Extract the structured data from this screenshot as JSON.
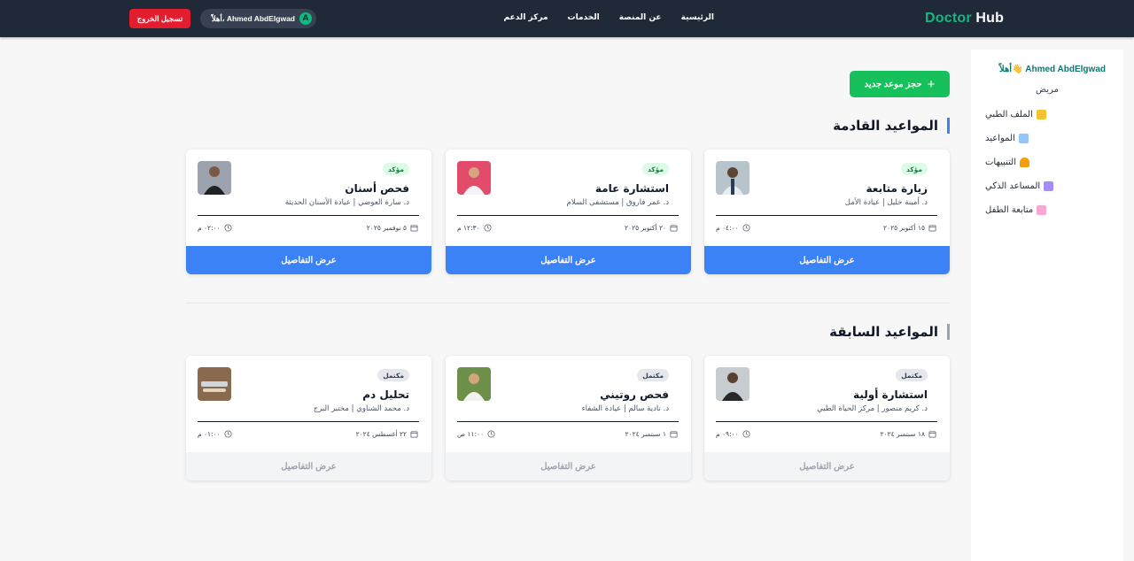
{
  "header": {
    "logo_part1": "Doctor",
    "logo_part2": "Hub",
    "nav": [
      "الرئيسية",
      "عن المنصة",
      "الخدمات",
      "مركز الدعم"
    ],
    "user_greeting": "أهلاً، Ahmed AbdElgwad",
    "user_initial": "A",
    "logout_label": "تسجيل الخروج"
  },
  "sidebar": {
    "greeting": "أهلاً👋 Ahmed AbdElgwad",
    "role": "مريض",
    "items": [
      {
        "label": "الملف الطبي",
        "icon": "folder-icon",
        "color": "#f4c430"
      },
      {
        "label": "المواعيد",
        "icon": "calendar-icon",
        "color": "#93c5fd"
      },
      {
        "label": "التنبيهات",
        "icon": "bell-icon",
        "color": "#f59e0b"
      },
      {
        "label": "المساعد الذكي",
        "icon": "robot-icon",
        "color": "#a78bfa"
      },
      {
        "label": "متابعة الطفل",
        "icon": "baby-bottle-icon",
        "color": "#f9a8d4"
      }
    ]
  },
  "main": {
    "book_label": "حجز موعد جديد",
    "upcoming_title": "المواعيد القادمة",
    "past_title": "المواعيد السابقة",
    "details_label": "عرض التفاصيل",
    "upcoming": [
      {
        "status": "مؤكد",
        "title": "زيارة متابعة",
        "doctor": "د. أمينة خليل | عيادة الأمل",
        "date": "١٥ أكتوبر ٢٠٢٥",
        "time": "٠٤:٠٠ م"
      },
      {
        "status": "مؤكد",
        "title": "استشارة عامة",
        "doctor": "د. عمر فاروق | مستشفى السلام",
        "date": "٢٠ أكتوبر ٢٠٢٥",
        "time": "١٢:٣٠ م"
      },
      {
        "status": "مؤكد",
        "title": "فحص أسنان",
        "doctor": "د. سارة العوضي | عيادة الأسنان الحديثة",
        "date": "٥ نوفمبر ٢٠٢٥",
        "time": "٠٢:٠٠ م"
      }
    ],
    "past": [
      {
        "status": "مكتمل",
        "title": "استشارة أولية",
        "doctor": "د. كريم منصور | مركز الحياة الطبي",
        "date": "١٨ سبتمبر ٢٠٢٤",
        "time": "٠٩:٠٠ م"
      },
      {
        "status": "مكتمل",
        "title": "فحص روتيني",
        "doctor": "د. نادية سالم | عيادة الشفاء",
        "date": "١ سبتمبر ٢٠٢٤",
        "time": "١١:٠٠ ص"
      },
      {
        "status": "مكتمل",
        "title": "تحليل دم",
        "doctor": "د. محمد الشناوي | مختبر البرج",
        "date": "٢٢ أغسطس ٢٠٢٤",
        "time": "٠١:٠٠ م"
      }
    ]
  }
}
